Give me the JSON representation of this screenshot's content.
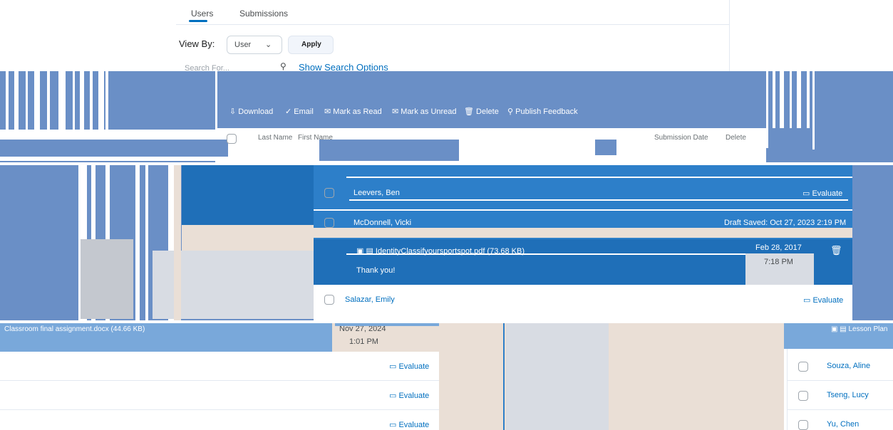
{
  "tabs": [
    {
      "label": "Users"
    },
    {
      "label": "Submissions"
    }
  ],
  "view_by": {
    "label": "View By:",
    "selected": "User",
    "apply_label": "Apply"
  },
  "search": {
    "placeholder": "Search For...",
    "show_options_label": "Show Search Options"
  },
  "toolbar": {
    "download": "Download",
    "email": "Email",
    "mark_read": "Mark as Read",
    "mark_unread": "Mark as Unread",
    "delete": "Delete",
    "publish_feedback": "Publish Feedback"
  },
  "table_header": {
    "last_name": "Last Name",
    "first_name": "First Name",
    "submission_date": "Submission Date",
    "delete": "Delete"
  },
  "rows": [
    {
      "name": "Leevers, Ben",
      "action": "Evaluate"
    },
    {
      "name": "McDonnell, Vicki",
      "draft_status": "Draft Saved: Oct 27, 2023 2:19 PM"
    },
    {
      "name": "Salazar, Emily",
      "action": "Evaluate"
    }
  ],
  "submission": {
    "file": "IdentityClassifyoursportspot.pdf (73.68 KB)",
    "comment": "Thank you!",
    "date": "Feb 28, 2017",
    "time": "7:18 PM"
  },
  "second_submission": {
    "file": "Classroom final assignment.docx (44.66 KB)",
    "date": "Nov 27, 2024",
    "time": "1:01 PM",
    "right_label": "Lesson Plan"
  },
  "bottom_left_rows": [
    {
      "action": "Evaluate"
    },
    {
      "action": "Evaluate"
    },
    {
      "action": "Evaluate"
    }
  ],
  "bottom_right_rows": [
    {
      "name": "Souza, Aline"
    },
    {
      "name": "Tseng, Lucy"
    },
    {
      "name": "Yu, Chen"
    }
  ],
  "colors": {
    "accent": "#006fbf",
    "band_blue": "#6a8fc6",
    "row_blue": "#2d7fc9",
    "peach": "#eadfd6"
  }
}
